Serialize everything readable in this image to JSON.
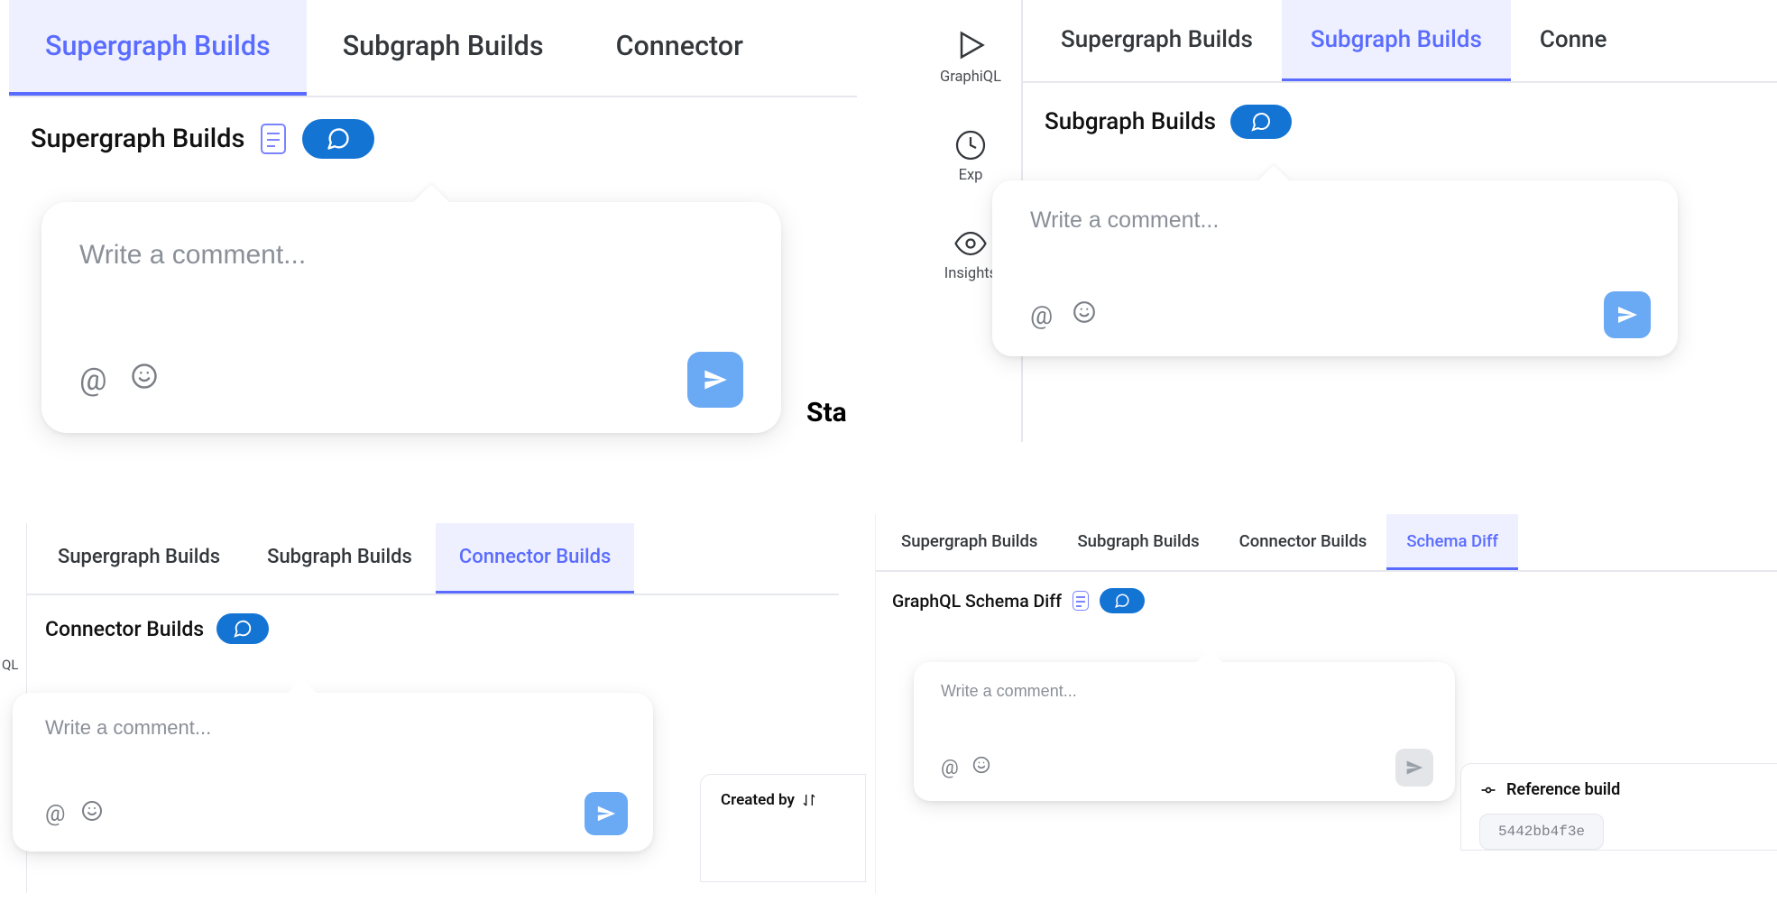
{
  "panels": {
    "top_left": {
      "tabs": [
        {
          "label": "Supergraph Builds",
          "active": true
        },
        {
          "label": "Subgraph Builds",
          "active": false
        },
        {
          "label": "Connector",
          "active": false
        }
      ],
      "heading": "Supergraph Builds",
      "comment_placeholder": "Write a comment...",
      "truncated_text": "Sta"
    },
    "top_right": {
      "rail": [
        {
          "label": "GraphiQL",
          "icon": "play-outline-icon"
        },
        {
          "label": "Exp",
          "icon": "eye-icon"
        },
        {
          "label": "Insights",
          "icon": "eye-outline-icon"
        }
      ],
      "tabs": [
        {
          "label": "Supergraph Builds",
          "active": false
        },
        {
          "label": "Subgraph Builds",
          "active": true
        },
        {
          "label": "Conne",
          "active": false
        }
      ],
      "heading": "Subgraph Builds",
      "comment_placeholder": "Write a comment..."
    },
    "bottom_left": {
      "rail_fragment": "QL",
      "tabs": [
        {
          "label": "Supergraph Builds",
          "active": false
        },
        {
          "label": "Subgraph Builds",
          "active": false
        },
        {
          "label": "Connector Builds",
          "active": true
        }
      ],
      "heading": "Connector Builds",
      "comment_placeholder": "Write a comment...",
      "created_by_text": "Created by"
    },
    "bottom_right": {
      "tabs": [
        {
          "label": "Supergraph Builds",
          "active": false
        },
        {
          "label": "Subgraph Builds",
          "active": false
        },
        {
          "label": "Connector Builds",
          "active": false
        },
        {
          "label": "Schema Diff",
          "active": true
        }
      ],
      "heading": "GraphQL Schema Diff",
      "comment_placeholder": "Write a comment...",
      "reference_build_label": "Reference build",
      "reference_build_hash": "5442bb4f3e"
    }
  },
  "colors": {
    "brand": "#5a6cff",
    "primary_btn": "#1474d4",
    "send_btn": "#6aa9f4"
  }
}
